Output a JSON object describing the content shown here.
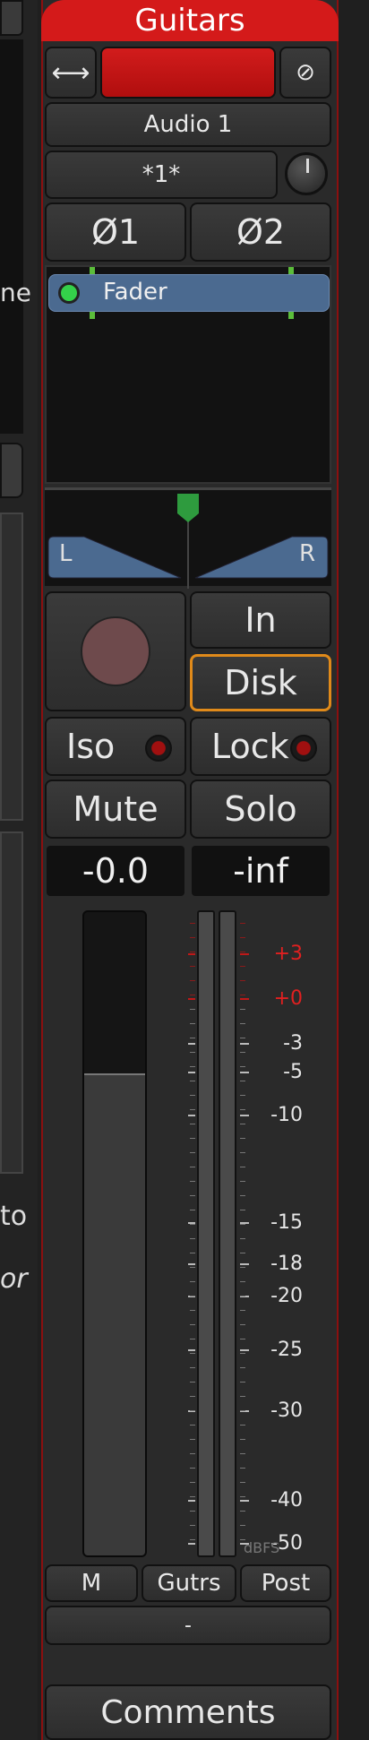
{
  "left_panel": {
    "partial_label_1": "ne",
    "partial_label_2": "to",
    "partial_label_3": "or"
  },
  "track": {
    "name": "Guitars",
    "input": "Audio 1",
    "playlist": "*1*",
    "phase_buttons": [
      "Ø1",
      "Ø2"
    ],
    "plugin": {
      "label": "Fader",
      "active": true
    },
    "pan": {
      "left": "L",
      "right": "R",
      "position": 0.5
    },
    "monitoring": {
      "in": "In",
      "disk": "Disk",
      "selected": "Disk"
    },
    "iso": "Iso",
    "lock": "Lock",
    "mute": "Mute",
    "solo": "Solo",
    "gain_readout": "-0.0",
    "peak_readout": "-inf",
    "fader_level": 0.75,
    "meter": {
      "scale": [
        {
          "label": "+3",
          "red": true
        },
        {
          "label": "+0",
          "red": true
        },
        {
          "label": "-3",
          "red": false
        },
        {
          "label": "-5",
          "red": false
        },
        {
          "label": "-10",
          "red": false
        },
        {
          "label": "-15",
          "red": false
        },
        {
          "label": "-18",
          "red": false
        },
        {
          "label": "-20",
          "red": false
        },
        {
          "label": "-25",
          "red": false
        },
        {
          "label": "-30",
          "red": false
        },
        {
          "label": "-40",
          "red": false
        },
        {
          "label": "-50",
          "red": false
        }
      ],
      "unit": "dBFS"
    },
    "bottom_buttons": [
      "M",
      "Gutrs",
      "Post"
    ],
    "output": "-",
    "comments": "Comments",
    "colors": {
      "title": "#d41a1a",
      "record_color": "#6e4a4c",
      "disk_outline": "#e08a1a",
      "plugin_bg": "#4b6a90",
      "pan_bg": "#4b6a90",
      "led_green": "#34d04a"
    }
  }
}
